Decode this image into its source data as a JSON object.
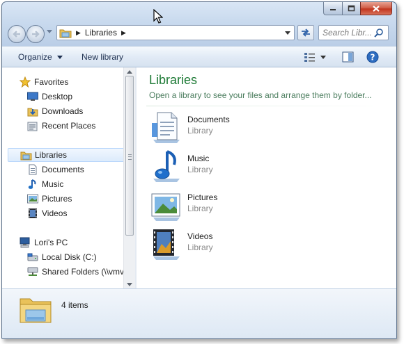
{
  "address": {
    "crumbs": [
      "Libraries"
    ]
  },
  "search": {
    "placeholder": "Search Libr..."
  },
  "toolbar": {
    "organize_label": "Organize",
    "new_library_label": "New library"
  },
  "sidebar": {
    "favorites": {
      "label": "Favorites",
      "items": [
        {
          "label": "Desktop",
          "icon": "desktop-icon"
        },
        {
          "label": "Downloads",
          "icon": "downloads-folder-icon"
        },
        {
          "label": "Recent Places",
          "icon": "recent-places-icon"
        }
      ]
    },
    "libraries": {
      "label": "Libraries",
      "items": [
        {
          "label": "Documents",
          "icon": "documents-icon"
        },
        {
          "label": "Music",
          "icon": "music-icon"
        },
        {
          "label": "Pictures",
          "icon": "pictures-icon"
        },
        {
          "label": "Videos",
          "icon": "videos-icon"
        }
      ]
    },
    "computer": {
      "label": "Lori's PC",
      "items": [
        {
          "label": "Local Disk (C:)",
          "icon": "hard-drive-icon"
        },
        {
          "label": "Shared Folders (\\\\vmv",
          "icon": "network-drive-icon"
        }
      ]
    }
  },
  "main": {
    "title": "Libraries",
    "subtitle": "Open a library to see your files and arrange them by folder...",
    "libraries": [
      {
        "name": "Documents",
        "type": "Library",
        "icon": "documents-library-icon"
      },
      {
        "name": "Music",
        "type": "Library",
        "icon": "music-library-icon"
      },
      {
        "name": "Pictures",
        "type": "Library",
        "icon": "pictures-library-icon"
      },
      {
        "name": "Videos",
        "type": "Library",
        "icon": "videos-library-icon"
      }
    ]
  },
  "details": {
    "item_count": "4 items"
  },
  "colors": {
    "title_green": "#1e7a36",
    "selection_blue": "#dcebfc",
    "close_red": "#c2361f"
  }
}
